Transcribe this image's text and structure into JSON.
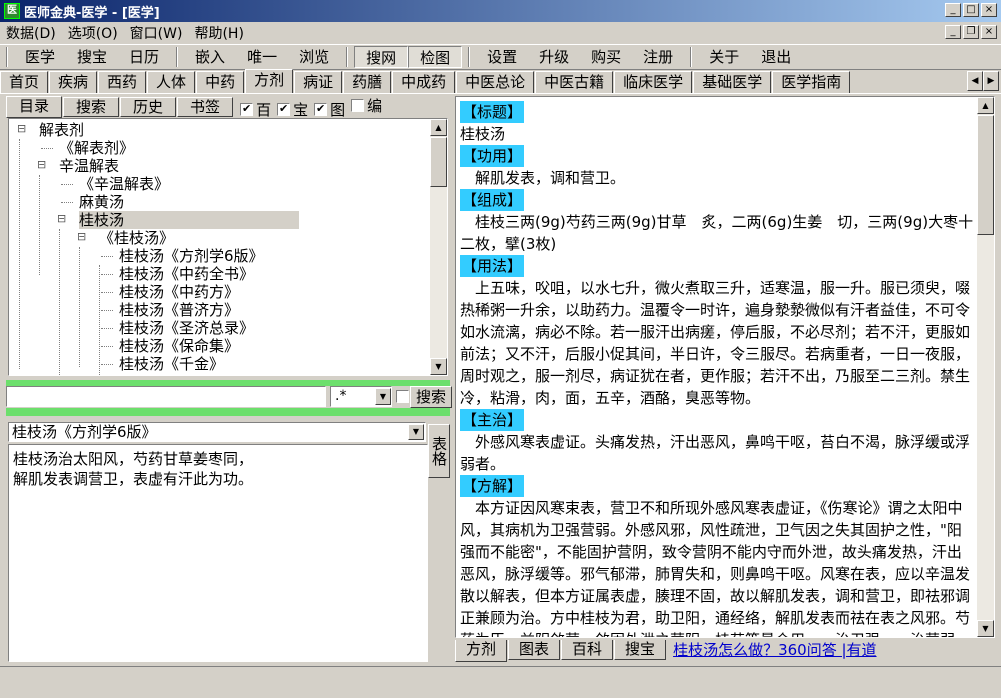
{
  "window": {
    "title": "医师金典-医学 - [医学]",
    "app_icon": "医"
  },
  "menu": [
    "数据(D)",
    "选项(O)",
    "窗口(W)",
    "帮助(H)"
  ],
  "toolbar": {
    "group1": [
      "医学",
      "搜宝",
      "日历"
    ],
    "group2": [
      "嵌入",
      "唯一",
      "浏览"
    ],
    "group3": [
      "搜网",
      "检图"
    ],
    "group4": [
      "设置",
      "升级",
      "购买",
      "注册"
    ],
    "group5": [
      "关于",
      "退出"
    ]
  },
  "category_tabs": [
    "首页",
    "疾病",
    "西药",
    "人体",
    "中药",
    "方剂",
    "病证",
    "药膳",
    "中成药",
    "中医总论",
    "中医古籍",
    "临床医学",
    "基础医学",
    "医学指南"
  ],
  "active_category": "方剂",
  "left_tabs": [
    "目录",
    "搜索",
    "历史",
    "书签"
  ],
  "filters": [
    {
      "label": "百",
      "checked": true
    },
    {
      "label": "宝",
      "checked": true
    },
    {
      "label": "图",
      "checked": true
    },
    {
      "label": "编",
      "checked": false
    }
  ],
  "tree": [
    {
      "label": "解表剂",
      "level": 0,
      "expander": "minus"
    },
    {
      "label": "《解表剂》",
      "level": 1
    },
    {
      "label": "辛温解表",
      "level": 1,
      "expander": "minus"
    },
    {
      "label": "《辛温解表》",
      "level": 2
    },
    {
      "label": "麻黄汤",
      "level": 2
    },
    {
      "label": "桂枝汤",
      "level": 2,
      "expander": "minus",
      "selected": true
    },
    {
      "label": "《桂枝汤》",
      "level": 3,
      "expander": "minus"
    },
    {
      "label": "桂枝汤《方剂学6版》",
      "level": 4
    },
    {
      "label": "桂枝汤《中药全书》",
      "level": 4
    },
    {
      "label": "桂枝汤《中药方》",
      "level": 4
    },
    {
      "label": "桂枝汤《普济方》",
      "level": 4
    },
    {
      "label": "桂枝汤《圣济总录》",
      "level": 4
    },
    {
      "label": "桂枝汤《保命集》",
      "level": 4
    },
    {
      "label": "桂枝汤《千金》",
      "level": 4
    }
  ],
  "search": {
    "input_value": "",
    "regex_value": ".*",
    "regex_checked": false,
    "button_label": "搜索"
  },
  "source": {
    "selected": "桂枝汤《方剂学6版》",
    "lines": [
      "桂枝汤治太阳风，芍药甘草姜枣同，",
      "解肌发表调营卫，表虚有汗此为功。"
    ],
    "side_tab": "表格"
  },
  "content": [
    {
      "header": "【标题】",
      "text": "桂枝汤",
      "indent": false
    },
    {
      "header": "【功用】",
      "text": "解肌发表，调和营卫。",
      "indent": true
    },
    {
      "header": "【组成】",
      "text": "桂枝三两(9g)芍药三两(9g)甘草　炙，二两(6g)生姜　切，三两(9g)大枣十二枚，擘(3枚)",
      "indent": true
    },
    {
      "header": "【用法】",
      "text": "上五味，㕮咀，以水七升，微火煮取三升，适寒温，服一升。服已须臾，啜热稀粥一升余，以助药力。温覆令一时许，遍身漐漐微似有汗者益佳，不可令如水流漓，病必不除。若一服汗出病瘥，停后服，不必尽剂；若不汗，更服如前法；又不汗，后服小促其间，半日许，令三服尽。若病重者，一日一夜服，周时观之，服一剂尽，病证犹在者，更作服；若汗不出，乃服至二三剂。禁生冷，粘滑，肉，面，五辛，酒酪，臭恶等物。",
      "indent": true
    },
    {
      "header": "【主治】",
      "text": "外感风寒表虚证。头痛发热，汗出恶风，鼻鸣干呕，苔白不渴，脉浮缓或浮弱者。",
      "indent": true
    },
    {
      "header": "【方解】",
      "text": "本方证因风寒束表，营卫不和所现外感风寒表虚证，《伤寒论》谓之太阳中风，其病机为卫强营弱。外感风邪，风性疏泄，卫气因之失其固护之性，\"阳强而不能密\"，不能固护营阴，致令营阴不能内守而外泄，故头痛发热，汗出恶风，脉浮缓等。邪气郁滞，肺胃失和，则鼻鸣干呕。风寒在表，应以辛温发散以解表，但本方证属表虚，腠理不固，故以解肌发表，调和营卫，即祛邪调正兼顾为治。方中桂枝为君，助卫阳，通经络，解肌发表而祛在表之风邪。芍药为臣，益阴敛营，敛固外泄之营阴。桂芍等量合用，一治卫强，一治营弱，散中",
      "indent": true
    }
  ],
  "bottom_tabs": [
    "方剂",
    "图表",
    "百科",
    "搜宝"
  ],
  "bottom_link": "桂枝汤怎么做？360问答 |有道",
  "colors": {
    "header_bg": "#33ccff",
    "green_bar": "#6cdf6c",
    "link": "#0000cc",
    "title_start": "#0a246a",
    "title_end": "#a6caf0"
  }
}
